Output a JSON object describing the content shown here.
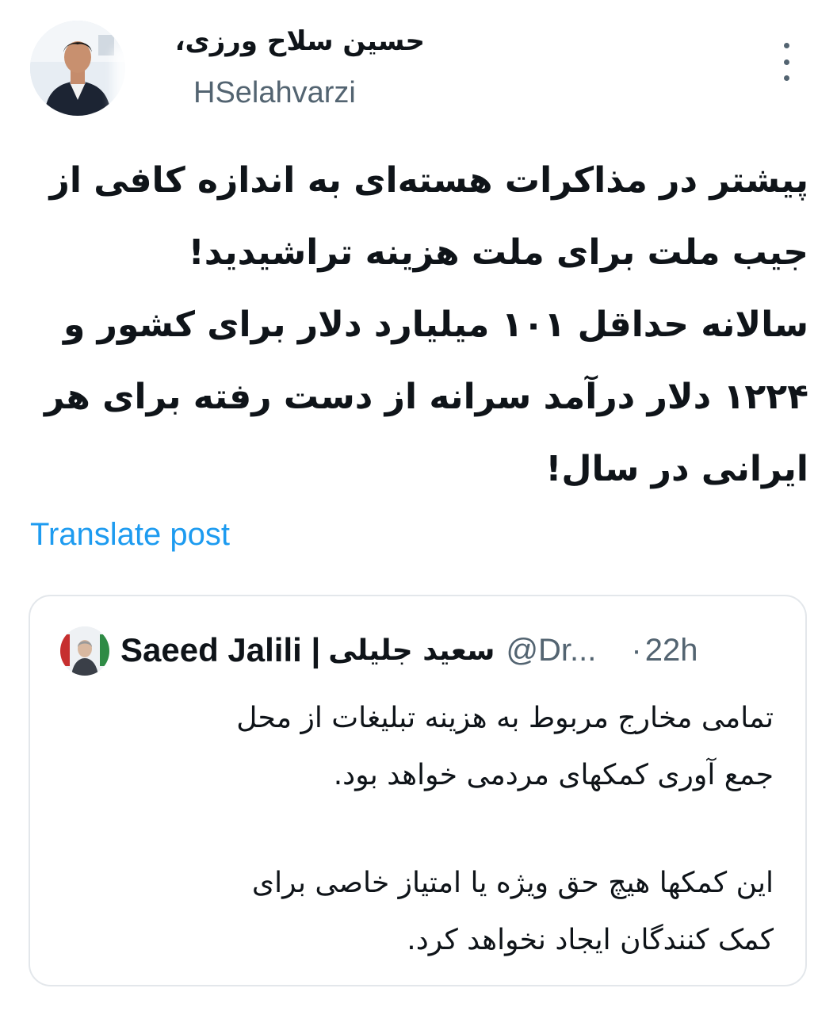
{
  "author": {
    "display_name": "حسین سلاح ورزی،",
    "handle": "HSelahvarzi"
  },
  "post": {
    "lines": [
      "پیشتر در مذاکرات هسته‌ای به اندازه کافی از",
      "جیب ملت برای ملت هزینه تراشیدید!",
      "سالانه حداقل ۱۰۱ میلیارد دلار برای کشور و",
      "۱۲۲۴ دلار درآمد سرانه از دست رفته برای هر",
      "ایرانی در سال!"
    ],
    "translate_label": "Translate post"
  },
  "quoted_post": {
    "author_name": "Saeed Jalili |",
    "author_name_fa": "سعید جلیلی",
    "handle": "@Dr...",
    "separator": "·",
    "time": "22h",
    "paragraph1": [
      "تمامی مخارج مربوط به هزینه تبلیغات از محل",
      "جمع آوری کمکهای مردمی خواهد بود."
    ],
    "paragraph2": [
      "این کمکها هیچ حق ویژه یا امتیاز خاصی برای",
      "کمک کنندگان ایجاد نخواهد کرد."
    ]
  },
  "icons": {
    "more": "more-vertical-icon"
  }
}
